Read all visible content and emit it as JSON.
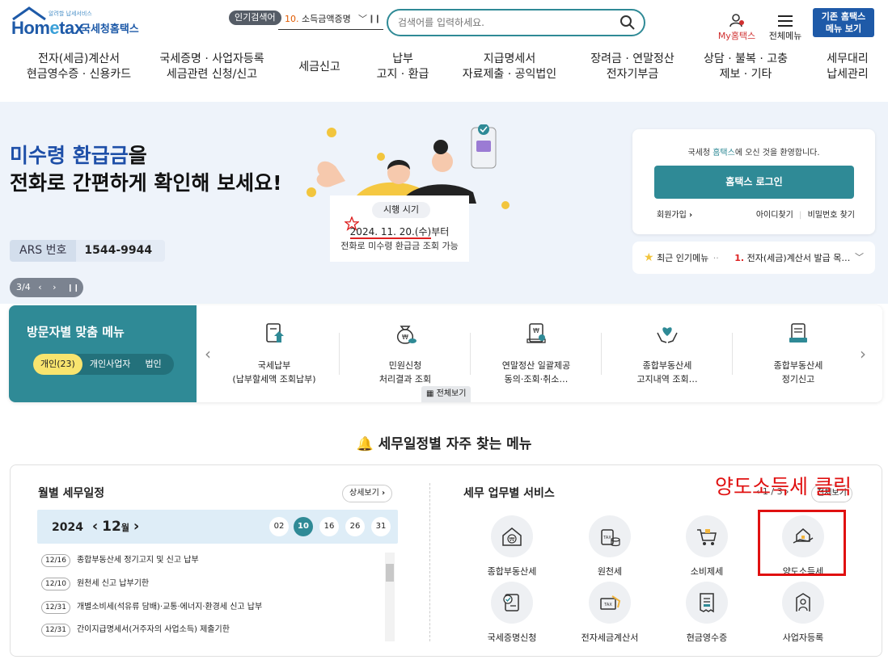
{
  "header": {
    "logo_sub": "알려할 납세서비스",
    "logo_word_a": "Hom",
    "logo_word_e": "e",
    "logo_word_b": "tax",
    "logo_kr": "국세청홈택스",
    "popular_badge": "인기검색어",
    "popular_num": "10.",
    "popular_item": "소득금액증명",
    "search_placeholder": "검색어를 입력하세요.",
    "my_hometax": "My홈택스",
    "all_menu": "전체메뉴",
    "old_menu_line1": "기존 홈택스",
    "old_menu_line2": "메뉴 보기"
  },
  "gnb": [
    {
      "l1": "전자(세금)계산서",
      "l2": "현금영수증 · 신용카드"
    },
    {
      "l1": "국세증명 · 사업자등록",
      "l2": "세금관련 신청/신고"
    },
    {
      "l1": "세금신고",
      "l2": ""
    },
    {
      "l1": "납부",
      "l2": "고지 · 환급"
    },
    {
      "l1": "지급명세서",
      "l2": "자료제출 · 공익법인"
    },
    {
      "l1": "장려금 · 연말정산",
      "l2": "전자기부금"
    },
    {
      "l1": "상담 · 불복 · 고충",
      "l2": "제보 · 기타"
    },
    {
      "l1": "세무대리",
      "l2": "납세관리"
    }
  ],
  "hero": {
    "title_hl": "미수령 환급금",
    "title_rest1": "을",
    "title_line2": "전화로 간편하게 확인해 보세요!",
    "ars_label": "ARS 번호",
    "ars_number": "1544-9944",
    "slide_counter": "3/4",
    "notice_pill": "시행 시기",
    "notice_date": "2024. 11. 20.(수)",
    "notice_date_suffix": "부터",
    "notice_desc": "전화로 미수령 환급금 조회 가능"
  },
  "login": {
    "welcome_a": "국세청 ",
    "welcome_hl": "홈택스",
    "welcome_b": "에 오신 것을 환영합니다.",
    "login_button": "홈택스 로그인",
    "signup": "회원가입",
    "find_id": "아이디찾기",
    "find_pw": "비밀번호 찾기",
    "popular_label": "최근 인기메뉴",
    "popular_num": "1.",
    "popular_item": "전자(세금)계산서 발급 목…"
  },
  "visitor": {
    "title": "방문자별 맞춤 메뉴",
    "tabs": [
      "개인(23)",
      "개인사업자",
      "법인"
    ],
    "items": [
      {
        "l1": "국세납부",
        "l2": "(납부할세액 조회납부)",
        "icon": "tax-payment-icon"
      },
      {
        "l1": "민원신청",
        "l2": "처리결과 조회",
        "icon": "money-bag-icon"
      },
      {
        "l1": "연말정산 일괄제공",
        "l2": "동의·조회·취소…",
        "icon": "document-stamp-icon"
      },
      {
        "l1": "종합부동산세",
        "l2": "고지내역 조회…",
        "icon": "heart-hands-icon"
      },
      {
        "l1": "종합부동산세",
        "l2": "정기신고",
        "icon": "report-form-icon"
      }
    ],
    "view_all": "전체보기"
  },
  "schedule": {
    "section_title": "세무일정별 자주 찾는 메뉴",
    "monthly_title": "월별 세무일정",
    "detail_button": "상세보기",
    "year": "2024",
    "month": "12",
    "month_unit": "월",
    "days": [
      "02",
      "10",
      "16",
      "26",
      "31"
    ],
    "selected_day": "10",
    "items": [
      {
        "date": "12/16",
        "text": "종합부동산세 정기고지 및 신고 납부"
      },
      {
        "date": "12/10",
        "text": "원천세 신고 납부기한"
      },
      {
        "date": "12/31",
        "text": "개별소비세(석유류 담배)·교통·에너지·환경세 신고 납부"
      },
      {
        "date": "12/31",
        "text": "간이지급명세서(거주자의 사업소득) 제출기한"
      }
    ]
  },
  "business": {
    "title": "세무 업무별 서비스",
    "page": "1 / 3",
    "view_all": "전체보기",
    "services": [
      {
        "label": "종합부동산세",
        "icon": "house-won-icon"
      },
      {
        "label": "원천세",
        "icon": "tax-cylinder-icon"
      },
      {
        "label": "소비제세",
        "icon": "shopping-cart-icon"
      },
      {
        "label": "양도소득세",
        "icon": "house-hand-icon"
      },
      {
        "label": "국세증명신청",
        "icon": "certificate-icon"
      },
      {
        "label": "전자세금계산서",
        "icon": "e-invoice-icon"
      },
      {
        "label": "현금영수증",
        "icon": "receipt-icon"
      },
      {
        "label": "사업자등록",
        "icon": "business-registration-icon"
      }
    ]
  },
  "annotation": {
    "text": "양도소득세 클릭",
    "color": "#e01010"
  },
  "colors": {
    "brand_blue": "#1e5aa8",
    "teal": "#2f8a96",
    "hero_bg": "#eef3fa",
    "tab_active": "#f8e46e"
  }
}
